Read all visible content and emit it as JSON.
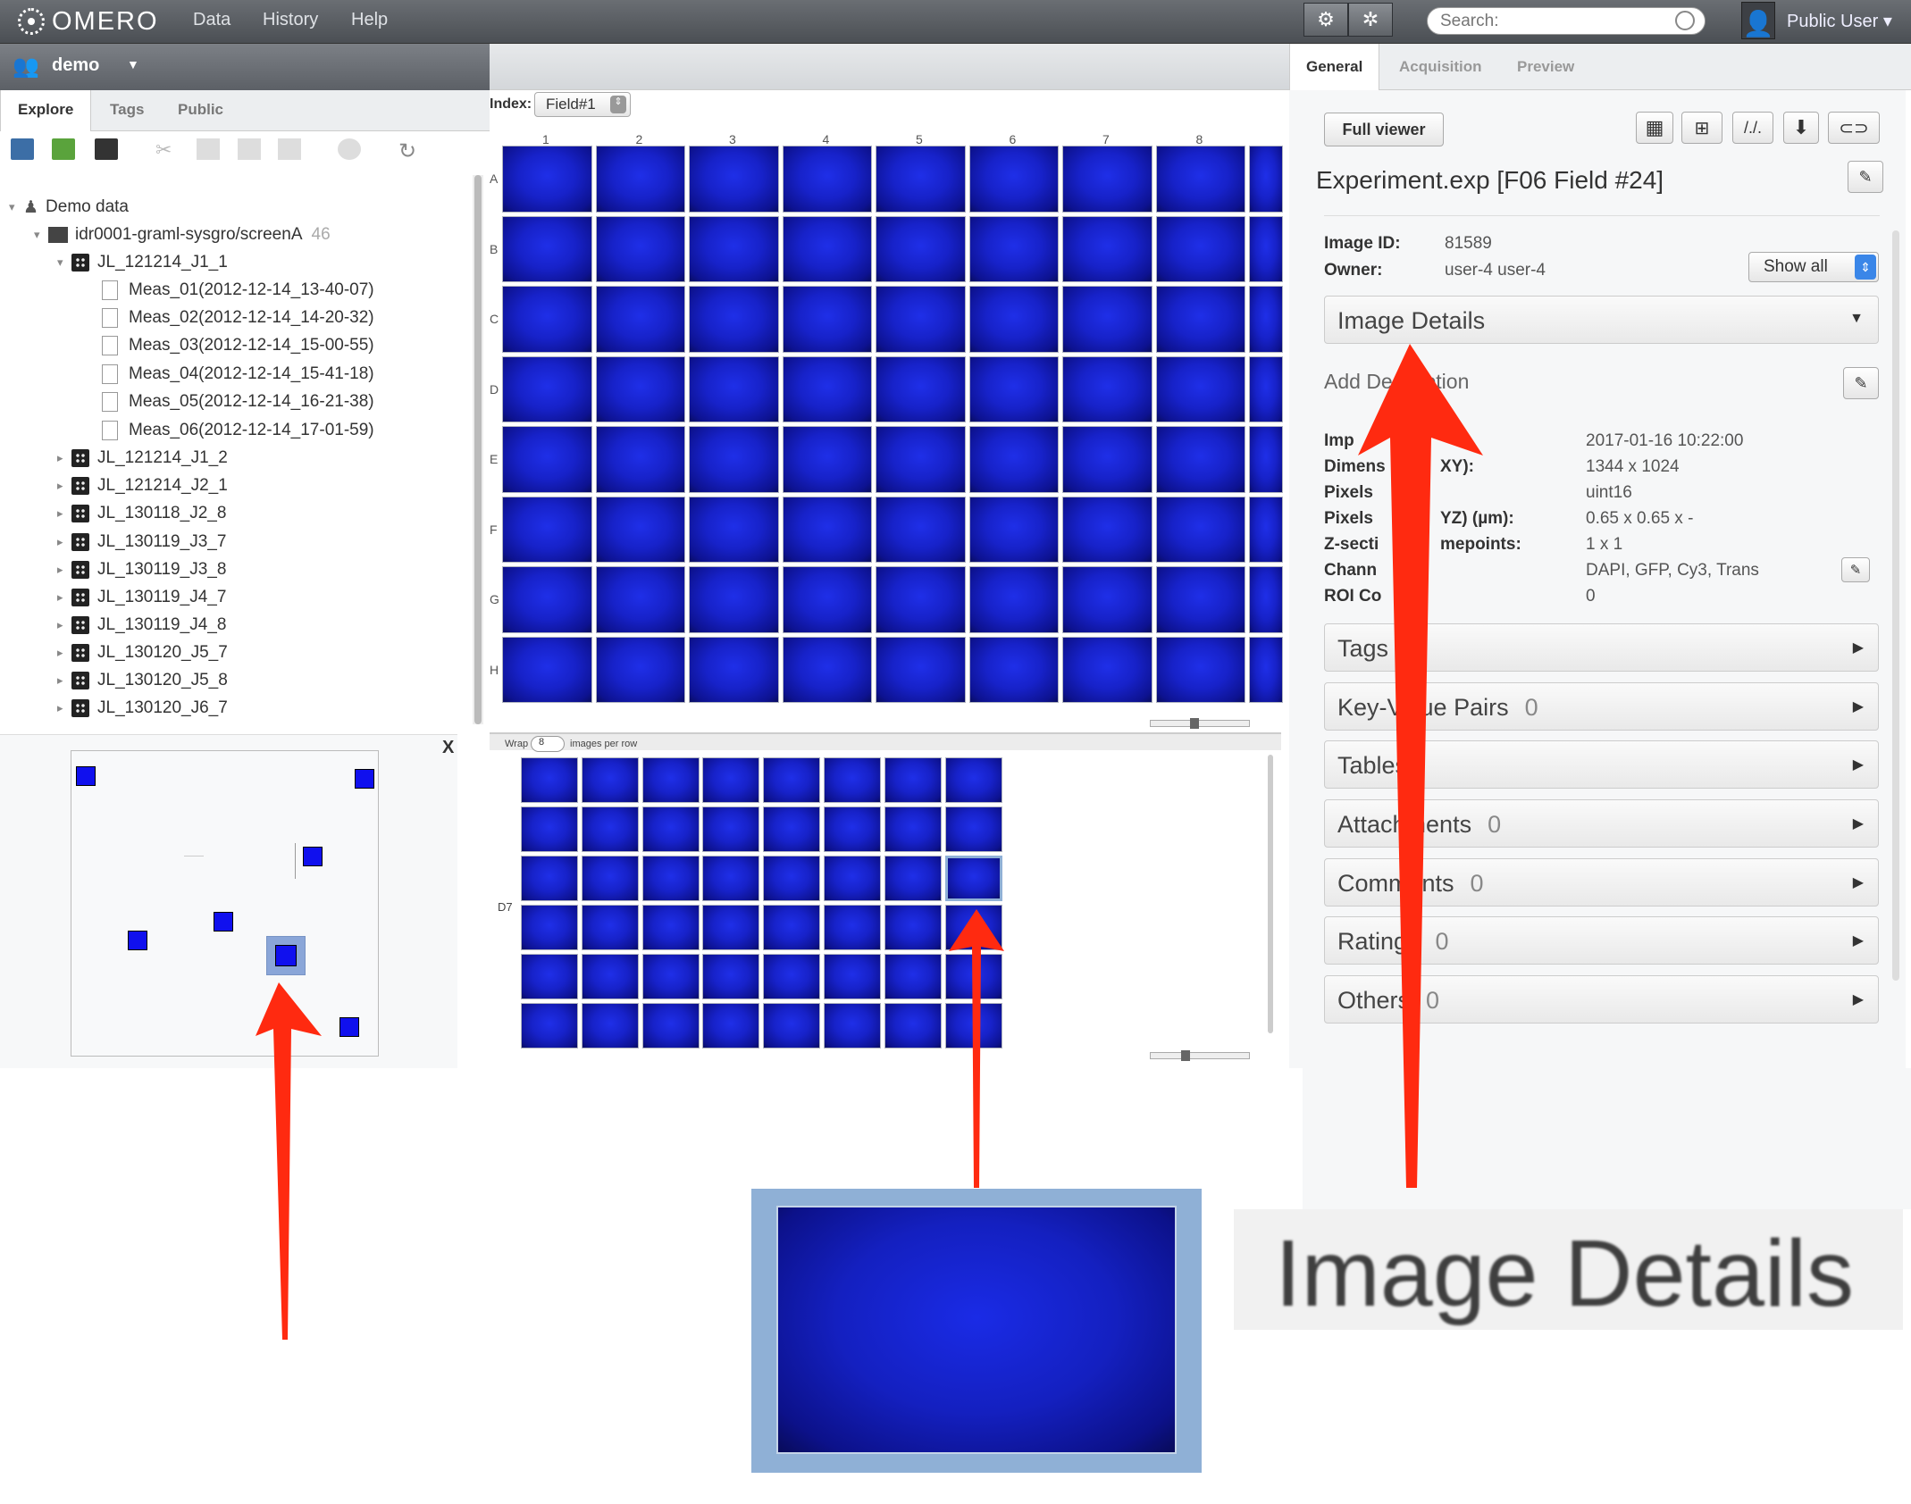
{
  "app": {
    "name": "OMERO",
    "nav": [
      "Data",
      "History",
      "Help"
    ],
    "search_placeholder": "Search:",
    "user": "Public User"
  },
  "left": {
    "group": "demo",
    "tabs": [
      "Explore",
      "Tags",
      "Public"
    ],
    "tree": {
      "root": "Demo data",
      "screen": {
        "name": "idr0001-graml-sysgro/screenA",
        "count": "46"
      },
      "plate_open": "JL_121214_J1_1",
      "runs": [
        "Meas_01(2012-12-14_13-40-07)",
        "Meas_02(2012-12-14_14-20-32)",
        "Meas_03(2012-12-14_15-00-55)",
        "Meas_04(2012-12-14_15-41-18)",
        "Meas_05(2012-12-14_16-21-38)",
        "Meas_06(2012-12-14_17-01-59)"
      ],
      "plates": [
        "JL_121214_J1_2",
        "JL_121214_J2_1",
        "JL_130118_J2_8",
        "JL_130119_J3_7",
        "JL_130119_J3_8",
        "JL_130119_J4_7",
        "JL_130119_J4_8",
        "JL_130120_J5_7",
        "JL_130120_J5_8",
        "JL_130120_J6_7"
      ]
    },
    "close_label": "X"
  },
  "center": {
    "index_label": "Index:",
    "index_value": "Field#1",
    "columns": [
      "1",
      "2",
      "3",
      "4",
      "5",
      "6",
      "7",
      "8"
    ],
    "rows": [
      "A",
      "B",
      "C",
      "D",
      "E",
      "F",
      "G",
      "H"
    ],
    "wrap_label": "Wrap",
    "wrap_value": "8",
    "wrap_suffix": "images per row",
    "well_label": "D7"
  },
  "right": {
    "tabs": [
      "General",
      "Acquisition",
      "Preview"
    ],
    "full_viewer": "Full viewer",
    "title": "Experiment.exp [F06 Field #24]",
    "image_id_label": "Image ID:",
    "image_id": "81589",
    "owner_label": "Owner:",
    "owner": "user-4 user-4",
    "show_all": "Show all",
    "image_details": "Image Details",
    "add_description": "Add Description",
    "meta_labels": [
      "Imp",
      "Dimens",
      "Pixels",
      "Pixels",
      "Z-secti",
      "Chann",
      "ROI Co"
    ],
    "meta_labels_tail": [
      "",
      "XY):",
      "",
      "YZ) (µm):",
      "mepoints:",
      "",
      ""
    ],
    "meta_values": [
      "2017-01-16 10:22:00",
      "1344 x 1024",
      "uint16",
      "0.65 x 0.65 x -",
      "1 x 1",
      "DAPI, GFP, Cy3, Trans",
      "0"
    ],
    "sections": [
      {
        "label": "Tags",
        "count": ""
      },
      {
        "label": "Key-Value Pairs",
        "count": "0"
      },
      {
        "label": "Tables",
        "count": ""
      },
      {
        "label": "Attachments",
        "count": "0"
      },
      {
        "label": "Comments",
        "count": "0"
      },
      {
        "label": "Ratings",
        "count": "0"
      },
      {
        "label": "Others",
        "count": "0"
      }
    ]
  },
  "callout": {
    "zoom_label": "Image Details"
  },
  "colors": {
    "arrow": "#ff2a10",
    "well_blue": "#1722c9"
  }
}
